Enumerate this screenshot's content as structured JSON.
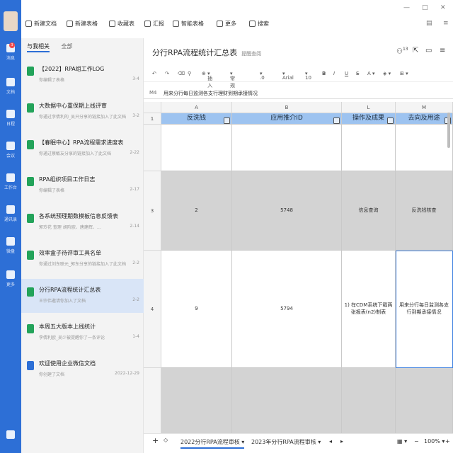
{
  "nav": {
    "badge": "3",
    "items": [
      {
        "label": "消息"
      },
      {
        "label": "文档"
      },
      {
        "label": "日程"
      },
      {
        "label": "会议"
      },
      {
        "label": "工作台"
      },
      {
        "label": "通讯录"
      },
      {
        "label": "微盘"
      },
      {
        "label": "更多"
      }
    ]
  },
  "toolbar": {
    "new_doc": "新建文档",
    "new_sheet": "新建表格",
    "favorites": "收藏表",
    "report": "汇报",
    "smart_sheet": "智能表格",
    "more": "更多",
    "search": "搜索"
  },
  "sidebar": {
    "tab_related": "与我相关",
    "tab_all": "全部",
    "docs": [
      {
        "title": "【2022】RPA组工作LOG",
        "sub": "你编辑了表格",
        "date": "3-4",
        "color": "green"
      },
      {
        "title": "大数据中心重保期上线评审",
        "sub": "你通过李倩利的_吴只分享的链接加入了此文档",
        "date": "3-2",
        "color": "green"
      },
      {
        "title": "【春眠中心】RPA流程需求进度表",
        "sub": "你通过蔡敏友分享的链接加入了此文档",
        "date": "2-22",
        "color": "green"
      },
      {
        "title": "RPA组织项目工作日志",
        "sub": "你编辑了表格",
        "date": "2-17",
        "color": "green"
      },
      {
        "title": "各系统预理期数模板信息反馈表",
        "sub": "郭玲花 查理 胡阶欧、唐建辉、…",
        "date": "2-14",
        "color": "green"
      },
      {
        "title": "效率盒子待评审工具名单",
        "sub": "你通过刘东联元_郭东分享的链接加入了此文档",
        "date": "2-2",
        "color": "green"
      },
      {
        "title": "分行RPA流程统计汇总表",
        "sub": "王宗伟邀请你加入了文档",
        "date": "2-2",
        "color": "green"
      },
      {
        "title": "本周五大版本上线统计",
        "sub": "李倩利欧_吴少被提醒你了一条评论",
        "date": "1-4",
        "color": "green"
      },
      {
        "title": "欢迎使用企业微信文档",
        "sub": "你创建了文档",
        "date": "2022-12-29",
        "color": "blue"
      }
    ]
  },
  "main": {
    "title": "分行RPA流程统计汇总表",
    "title_sub": "提醒查阅",
    "avatar_count": "13",
    "format": {
      "insert": "插入",
      "style": "常规",
      "decimal": ".0",
      "font": "Arial",
      "size": "10",
      "zoom": "100%"
    },
    "formula": {
      "cell": "M4",
      "value": "用来分行每日监测各支行理财到期承接情况"
    },
    "columns": [
      "A",
      "B",
      "L",
      "M"
    ],
    "headers": [
      "反洗钱",
      "应用推介ID",
      "操作及成果",
      "去向及用途"
    ],
    "rows": [
      {
        "num": "",
        "cells": [
          "",
          "",
          "",
          ""
        ]
      },
      {
        "num": "3",
        "cells": [
          "2",
          "5748",
          "信息查询",
          "反洗钱核查"
        ]
      },
      {
        "num": "4",
        "cells": [
          "9",
          "5794",
          "1) 在CDM系统下载两张报表(n2)制表",
          "用来分行每日监测各支行到期承接情况"
        ]
      }
    ],
    "sheets": [
      "2022分行RPA流程审核",
      "2023年分行RPA流程审核"
    ]
  }
}
